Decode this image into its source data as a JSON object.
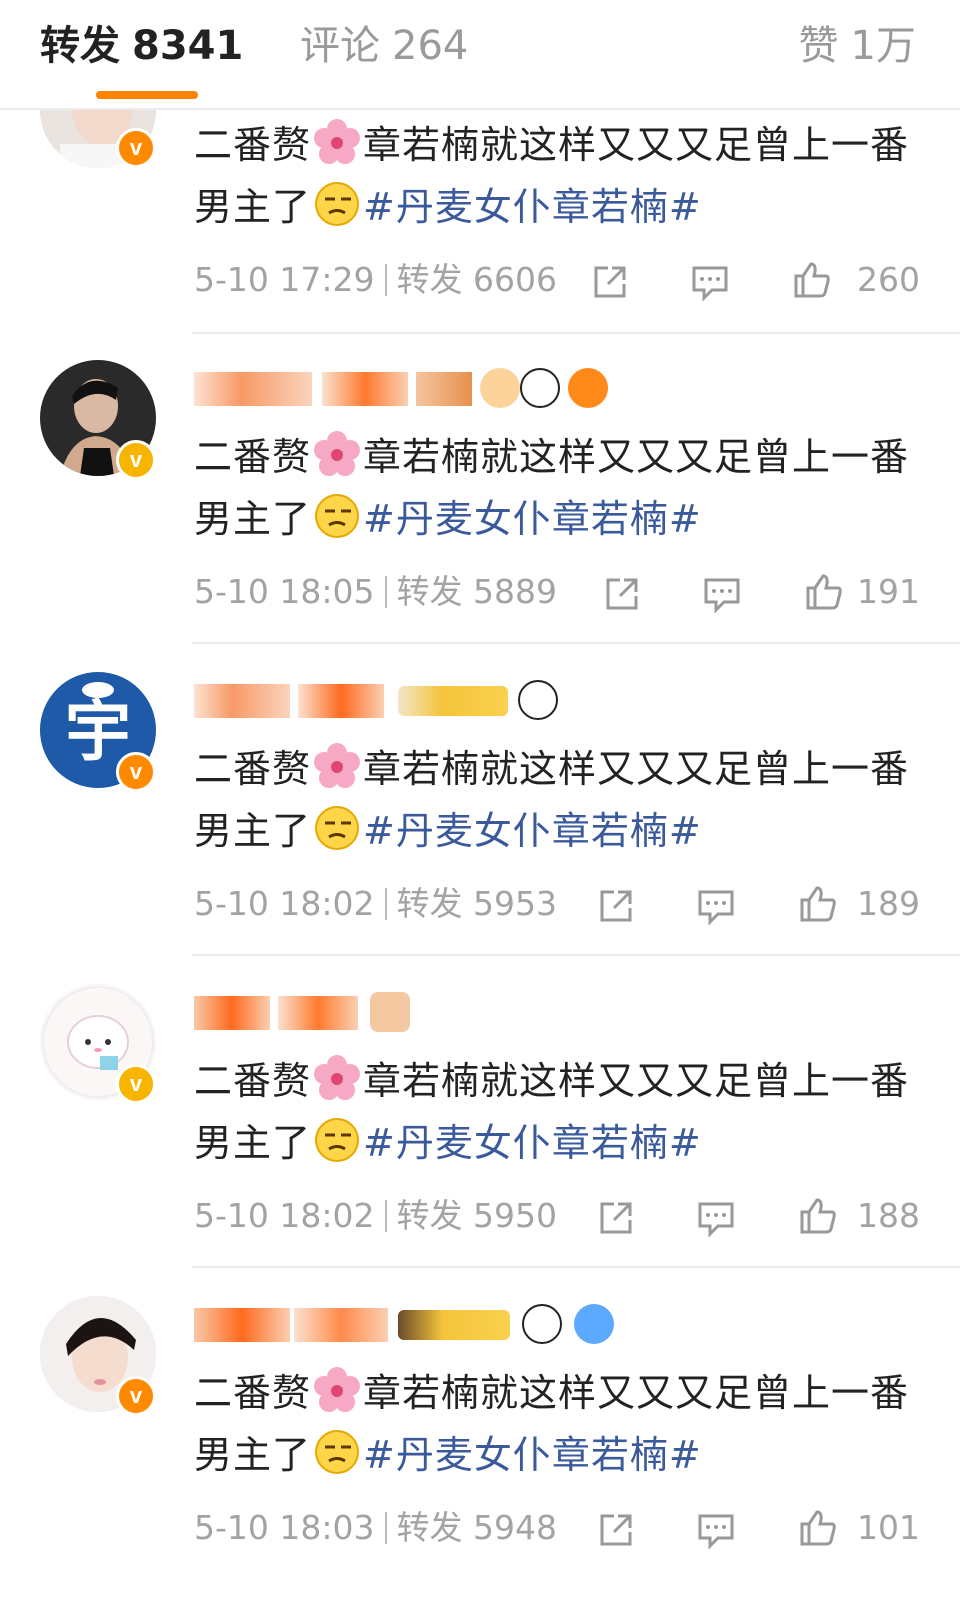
{
  "tabs": {
    "repost_label": "转发",
    "repost_count": "8341",
    "comment_label": "评论",
    "comment_count": "264",
    "like_label": "赞",
    "like_count": "1万",
    "active_color": "#ff8200"
  },
  "reposts": [
    {
      "text": "二番赘",
      "text2": "章若楠就这样又又又足曾上一番男主了",
      "hashtag": "#丹麦女仆章若楠#",
      "time": "5-10 17:29",
      "repost_label": "转发",
      "repost_count": "6606",
      "likes": "260",
      "badge": "orange",
      "avatar": "portrait-light"
    },
    {
      "text": "二番赘",
      "text2": "章若楠就这样又又又足曾上一番男主了",
      "hashtag": "#丹麦女仆章若楠#",
      "time": "5-10 18:05",
      "repost_label": "转发",
      "repost_count": "5889",
      "likes": "191",
      "badge": "gold",
      "avatar": "portrait-dark"
    },
    {
      "text": "二番赘",
      "text2": "章若楠就这样又又又足曾上一番男主了",
      "hashtag": "#丹麦女仆章若楠#",
      "time": "5-10 18:02",
      "repost_label": "转发",
      "repost_count": "5953",
      "likes": "189",
      "badge": "orange",
      "avatar": "logo-blue"
    },
    {
      "text": "二番赘",
      "text2": "章若楠就这样又又又足曾上一番男主了",
      "hashtag": "#丹麦女仆章若楠#",
      "time": "5-10 18:02",
      "repost_label": "转发",
      "repost_count": "5950",
      "likes": "188",
      "badge": "gold",
      "avatar": "cartoon-bunny"
    },
    {
      "text": "二番赘",
      "text2": "章若楠就这样又又又足曾上一番男主了",
      "hashtag": "#丹麦女仆章若楠#",
      "time": "5-10 18:03",
      "repost_label": "转发",
      "repost_count": "5948",
      "likes": "101",
      "badge": "orange",
      "avatar": "portrait-light"
    }
  ]
}
